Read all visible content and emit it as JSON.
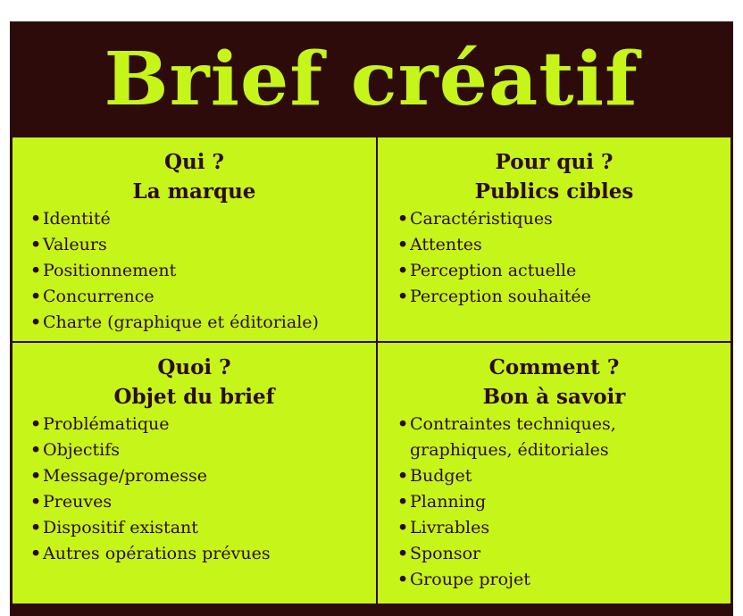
{
  "title": "Brief créatif",
  "quadrants": {
    "top_left": {
      "title": "Qui ?",
      "subtitle": "La marque",
      "items": [
        "Identité",
        "Valeurs",
        "Positionnement",
        "Concurrence",
        "Charte (graphique et éditoriale)"
      ]
    },
    "top_right": {
      "title": "Pour qui ?",
      "subtitle": "Publics cibles",
      "items": [
        "Caractéristiques",
        "Attentes",
        "Perception actuelle",
        "Perception souhaitée"
      ]
    },
    "bottom_left": {
      "title": "Quoi ?",
      "subtitle": "Objet du brief",
      "items": [
        "Problématique",
        "Objectifs",
        "Message/promesse",
        "Preuves",
        "Dispositif existant",
        "Autres opérations prévues"
      ]
    },
    "bottom_right": {
      "title": "Comment ?",
      "subtitle": "Bon à savoir",
      "items_first_line": "Contraintes  techniques,",
      "items_first_line_cont": "graphiques, éditoriales",
      "items": [
        "Budget",
        "Planning",
        "Livrables",
        "Sponsor",
        "Groupe projet"
      ]
    }
  },
  "colors": {
    "background": "#2e0b0b",
    "accent": "#c6f51a"
  }
}
